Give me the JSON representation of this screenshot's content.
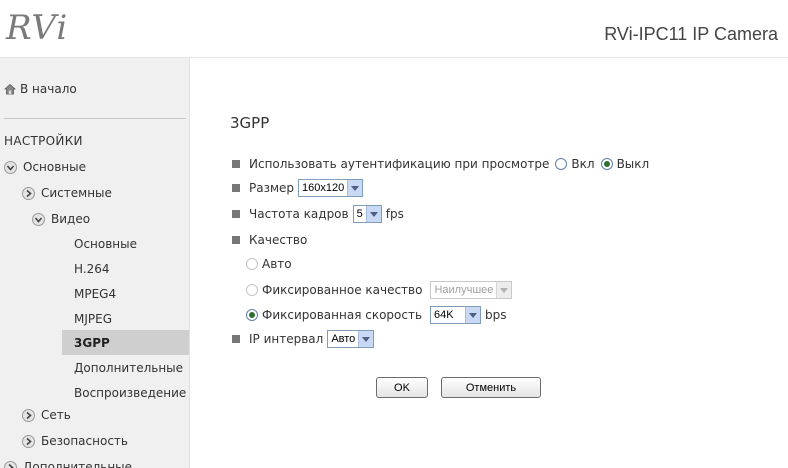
{
  "header": {
    "logo": "RVi",
    "title": "RVi-IPC11 IP Camera"
  },
  "sidebar": {
    "home_label": "В начало",
    "section_label": "НАСТРОЙКИ",
    "basic_label": "Основные",
    "system_label": "Системные",
    "video_label": "Видео",
    "video_items": [
      "Основные",
      "H.264",
      "MPEG4",
      "MJPEG",
      "3GPP",
      "Дополнительные",
      "Воспроизведение"
    ],
    "active_item": "3GPP",
    "network_label": "Сеть",
    "security_label": "Безопасность",
    "additional_label": "Дополнительные"
  },
  "main": {
    "page_title": "3GPP",
    "auth": {
      "label": "Использовать аутентификацию при просмотре",
      "on_label": "Вкл",
      "off_label": "Выкл",
      "selected": "off"
    },
    "size": {
      "label": "Размер",
      "value": "160x120"
    },
    "framerate": {
      "label": "Частота кадров",
      "value": "5",
      "unit": "fps"
    },
    "quality": {
      "label": "Качество",
      "auto_label": "Авто",
      "fixed_quality_label": "Фиксированное качество",
      "fixed_quality_value": "Наилучшее",
      "fixed_rate_label": "Фиксированная скорость",
      "fixed_rate_value": "64K",
      "fixed_rate_unit": "bps",
      "selected": "fixed_rate"
    },
    "ip_interval": {
      "label": "IP интервал",
      "value": "Авто"
    },
    "ok_label": "OK",
    "cancel_label": "Отменить"
  },
  "colors": {
    "sidebar_bg": "#f0f0f0",
    "active_item_bg": "#cfcfcf",
    "select_button": "#c8d8f5",
    "radio_checked": "#2e6e2e"
  }
}
